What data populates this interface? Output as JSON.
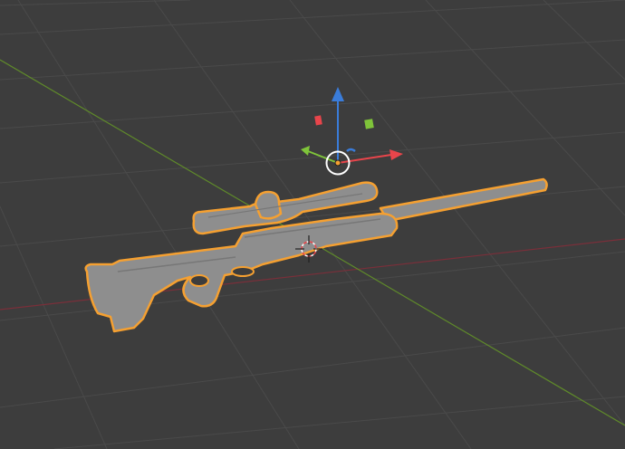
{
  "viewport": {
    "mode": "3D Viewport",
    "background_color": "#3d3d3d",
    "grid_color": "#4a4a4a",
    "x_axis_color": "#7a2f3a",
    "y_axis_color": "#5f8a2a"
  },
  "selection": {
    "object": "sniper-rifle-model",
    "outline_color": "#f5a031",
    "mesh_color": "#8e8e8e"
  },
  "gizmo": {
    "x_color": "#e8454b",
    "y_color": "#7fc43a",
    "z_color": "#3a7cd9"
  },
  "cursor_3d": {
    "icon": "3d-cursor-icon"
  }
}
